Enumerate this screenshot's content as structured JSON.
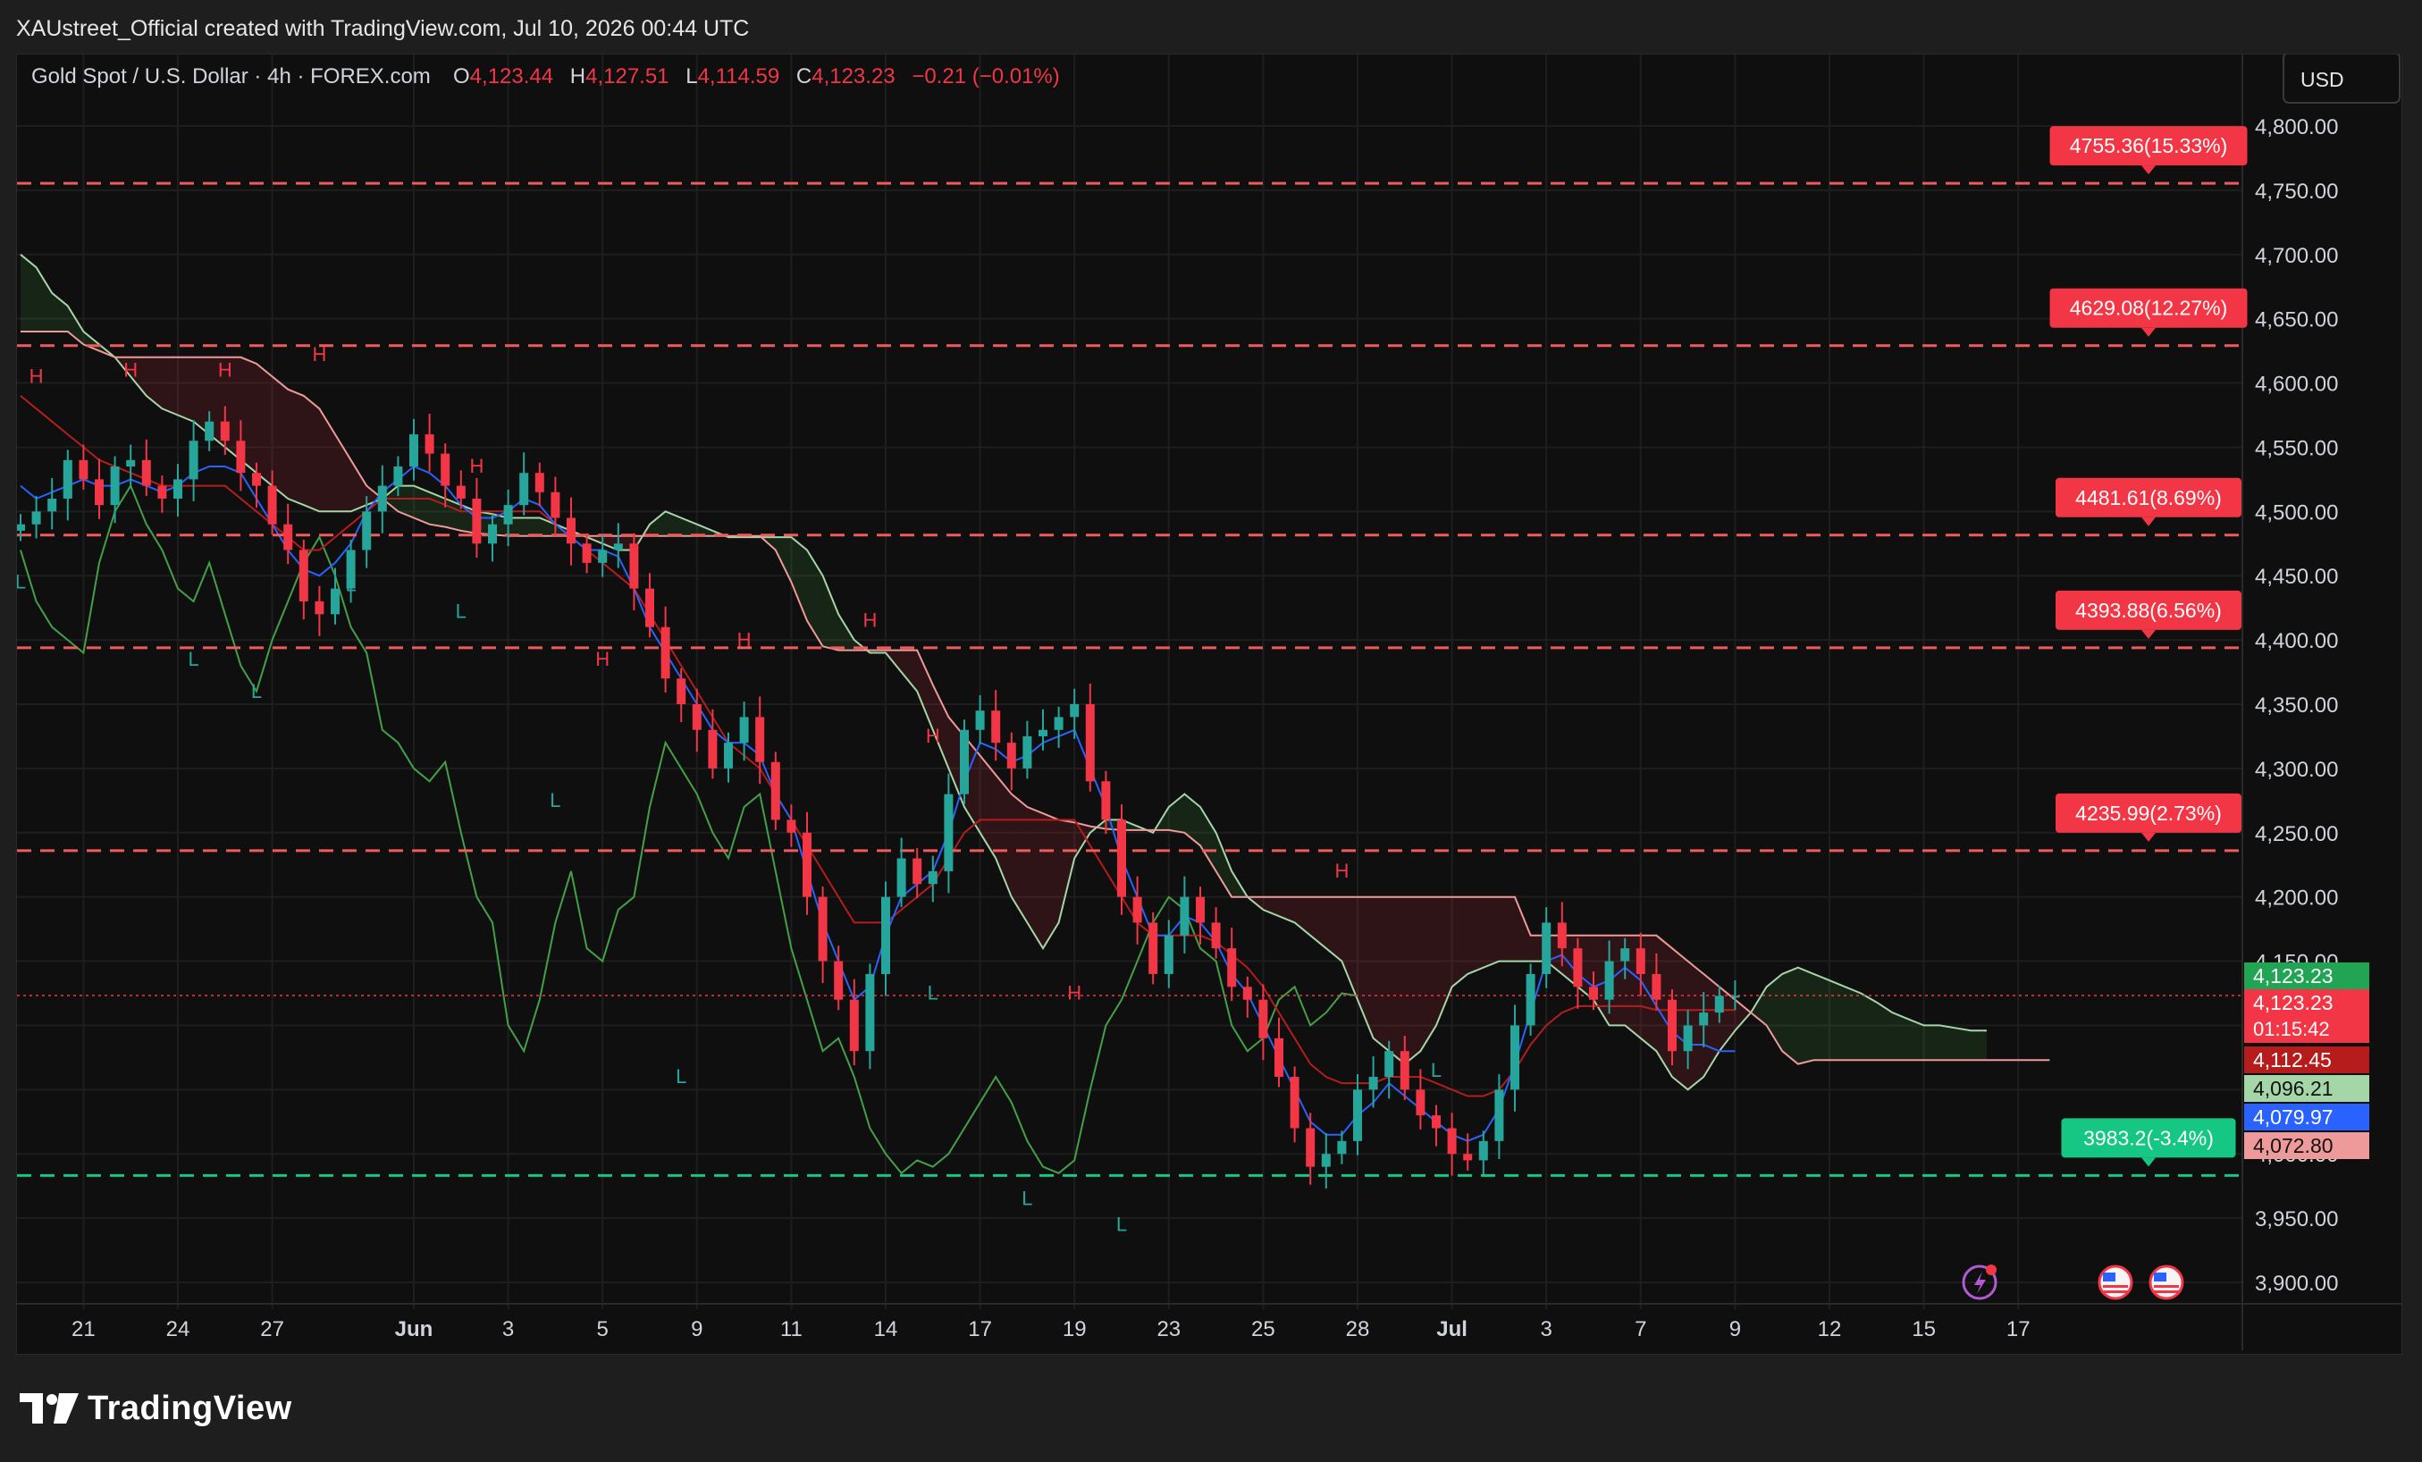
{
  "header": {
    "title": "XAUstreet_Official created with TradingView.com, Jul 10, 2026 00:44 UTC"
  },
  "legend": {
    "symbol": "Gold Spot / U.S. Dollar · 4h · FOREX.com",
    "o_label": "O",
    "o_value": "4,123.44",
    "h_label": "H",
    "h_value": "4,127.51",
    "l_label": "L",
    "l_value": "4,114.59",
    "c_label": "C",
    "c_value": "4,123.23",
    "change": "−0.21 (−0.01%)"
  },
  "currency_button": "USD",
  "footer": {
    "brand": "TradingView"
  },
  "colors": {
    "up": "#26a69a",
    "down": "#f23645",
    "resistance": "#f05a5a",
    "support": "#22c55e",
    "conversion": "#2962ff",
    "base": "#b71c1c",
    "lagging": "#43a047",
    "span_a": "#a5d6a7",
    "span_b": "#ef9a9a"
  },
  "chart_data": {
    "type": "candlestick",
    "y_axis": {
      "min": 3900,
      "max": 4800,
      "ticks": [
        "4,800.00",
        "4,750.00",
        "4,700.00",
        "4,650.00",
        "4,600.00",
        "4,550.00",
        "4,500.00",
        "4,450.00",
        "4,400.00",
        "4,350.00",
        "4,300.00",
        "4,250.00",
        "4,200.00",
        "4,150.00",
        "4,100.00",
        "4,050.00",
        "4,000.00",
        "3,950.00",
        "3,900.00"
      ],
      "tick_values": [
        4800,
        4750,
        4700,
        4650,
        4600,
        4550,
        4500,
        4450,
        4400,
        4350,
        4300,
        4250,
        4200,
        4150,
        4100,
        4050,
        4000,
        3950,
        3900
      ]
    },
    "x_axis": {
      "labels": [
        {
          "text": "21",
          "i": 4,
          "bold": false
        },
        {
          "text": "24",
          "i": 10,
          "bold": false
        },
        {
          "text": "27",
          "i": 16,
          "bold": false
        },
        {
          "text": "Jun",
          "i": 25,
          "bold": true
        },
        {
          "text": "3",
          "i": 31,
          "bold": false
        },
        {
          "text": "5",
          "i": 37,
          "bold": false
        },
        {
          "text": "9",
          "i": 43,
          "bold": false
        },
        {
          "text": "11",
          "i": 49,
          "bold": false
        },
        {
          "text": "14",
          "i": 55,
          "bold": false
        },
        {
          "text": "17",
          "i": 61,
          "bold": false
        },
        {
          "text": "19",
          "i": 67,
          "bold": false
        },
        {
          "text": "23",
          "i": 73,
          "bold": false
        },
        {
          "text": "25",
          "i": 79,
          "bold": false
        },
        {
          "text": "28",
          "i": 85,
          "bold": false
        },
        {
          "text": "Jul",
          "i": 91,
          "bold": true
        },
        {
          "text": "3",
          "i": 97,
          "bold": false
        },
        {
          "text": "7",
          "i": 103,
          "bold": false
        },
        {
          "text": "9",
          "i": 109,
          "bold": false
        },
        {
          "text": "12",
          "i": 115,
          "bold": false
        },
        {
          "text": "15",
          "i": 121,
          "bold": false
        },
        {
          "text": "17",
          "i": 127,
          "bold": false
        }
      ]
    },
    "levels": [
      {
        "value": 4755.36,
        "label": "4755.36(15.33%)",
        "kind": "resistance"
      },
      {
        "value": 4629.08,
        "label": "4629.08(12.27%)",
        "kind": "resistance"
      },
      {
        "value": 4481.61,
        "label": "4481.61(8.69%)",
        "kind": "resistance"
      },
      {
        "value": 4393.88,
        "label": "4393.88(6.56%)",
        "kind": "resistance"
      },
      {
        "value": 4235.99,
        "label": "4235.99(2.73%)",
        "kind": "resistance"
      },
      {
        "value": 3983.2,
        "label": "3983.2(-3.4%)",
        "kind": "support"
      }
    ],
    "last_price": 4123.23,
    "price_tags": [
      {
        "text": "4,123.23",
        "value": 4123.23,
        "color": "#22a455"
      },
      {
        "text": "4,123.23",
        "sub": "01:15:42",
        "value": 4123.23,
        "color": "#f23645"
      },
      {
        "text": "4,112.45",
        "value": 4112.45,
        "color": "#b71c1c"
      },
      {
        "text": "4,096.21",
        "value": 4096.21,
        "color": "#a5d6a7"
      },
      {
        "text": "4,079.97",
        "value": 4079.97,
        "color": "#2962ff"
      },
      {
        "text": "4,072.80",
        "value": 4072.8,
        "color": "#ef9a9a"
      }
    ],
    "close": [
      4490,
      4500,
      4510,
      4540,
      4525,
      4505,
      4535,
      4540,
      4520,
      4510,
      4525,
      4555,
      4570,
      4555,
      4530,
      4520,
      4490,
      4470,
      4430,
      4420,
      4440,
      4470,
      4500,
      4520,
      4535,
      4560,
      4545,
      4520,
      4510,
      4475,
      4490,
      4505,
      4530,
      4515,
      4495,
      4475,
      4460,
      4470,
      4475,
      4440,
      4410,
      4370,
      4350,
      4330,
      4300,
      4320,
      4340,
      4305,
      4260,
      4250,
      4200,
      4150,
      4120,
      4080,
      4140,
      4200,
      4230,
      4210,
      4220,
      4280,
      4330,
      4345,
      4320,
      4300,
      4325,
      4330,
      4340,
      4350,
      4290,
      4260,
      4200,
      4180,
      4140,
      4170,
      4200,
      4180,
      4160,
      4130,
      4120,
      4090,
      4060,
      4020,
      3990,
      4000,
      4010,
      4050,
      4060,
      4080,
      4050,
      4030,
      4020,
      4000,
      3995,
      4010,
      4050,
      4100,
      4140,
      4180,
      4160,
      4130,
      4120,
      4150,
      4160,
      4140,
      4120,
      4080,
      4100,
      4110,
      4123,
      4123
    ],
    "tenkan": [
      4520,
      4510,
      4515,
      4520,
      4525,
      4520,
      4520,
      4525,
      4520,
      4515,
      4520,
      4530,
      4535,
      4535,
      4530,
      4510,
      4490,
      4470,
      4455,
      4450,
      4460,
      4475,
      4500,
      4515,
      4525,
      4535,
      4530,
      4520,
      4505,
      4495,
      4495,
      4500,
      4510,
      4505,
      4490,
      4480,
      4470,
      4470,
      4465,
      4440,
      4410,
      4390,
      4370,
      4350,
      4330,
      4320,
      4320,
      4310,
      4280,
      4260,
      4220,
      4180,
      4150,
      4120,
      4130,
      4170,
      4200,
      4210,
      4220,
      4250,
      4290,
      4320,
      4315,
      4305,
      4310,
      4320,
      4325,
      4330,
      4300,
      4270,
      4230,
      4200,
      4170,
      4170,
      4185,
      4180,
      4165,
      4140,
      4125,
      4100,
      4075,
      4050,
      4025,
      4015,
      4015,
      4030,
      4040,
      4055,
      4045,
      4035,
      4025,
      4015,
      4010,
      4015,
      4035,
      4070,
      4110,
      4150,
      4155,
      4140,
      4130,
      4135,
      4145,
      4135,
      4115,
      4095,
      4085,
      4085,
      4080,
      4080
    ],
    "kijun": [
      4590,
      4580,
      4570,
      4560,
      4550,
      4540,
      4535,
      4530,
      4525,
      4520,
      4520,
      4520,
      4520,
      4520,
      4510,
      4500,
      4490,
      4480,
      4470,
      4470,
      4480,
      4490,
      4500,
      4510,
      4510,
      4510,
      4510,
      4505,
      4500,
      4500,
      4500,
      4500,
      4500,
      4500,
      4490,
      4480,
      4470,
      4460,
      4450,
      4440,
      4420,
      4400,
      4380,
      4360,
      4340,
      4320,
      4310,
      4300,
      4280,
      4260,
      4240,
      4220,
      4200,
      4180,
      4180,
      4180,
      4190,
      4200,
      4210,
      4230,
      4250,
      4260,
      4260,
      4260,
      4260,
      4260,
      4260,
      4260,
      4240,
      4220,
      4200,
      4180,
      4170,
      4170,
      4170,
      4170,
      4165,
      4155,
      4145,
      4130,
      4110,
      4090,
      4070,
      4060,
      4055,
      4055,
      4055,
      4060,
      4060,
      4060,
      4055,
      4050,
      4045,
      4045,
      4050,
      4065,
      4085,
      4100,
      4110,
      4115,
      4115,
      4115,
      4115,
      4115,
      4112,
      4112,
      4112,
      4112,
      4112,
      4112
    ],
    "chikou": [
      4470,
      4430,
      4410,
      4400,
      4390,
      4460,
      4500,
      4520,
      4490,
      4470,
      4440,
      4430,
      4460,
      4420,
      4380,
      4360,
      4400,
      4430,
      4460,
      4480,
      4450,
      4410,
      4390,
      4330,
      4320,
      4300,
      4290,
      4305,
      4250,
      4200,
      4180,
      4100,
      4080,
      4120,
      4180,
      4220,
      4160,
      4150,
      4190,
      4200,
      4270,
      4320,
      4300,
      4280,
      4250,
      4230,
      4270,
      4280,
      4220,
      4160,
      4120,
      4080,
      4090,
      4060,
      4020,
      4000,
      3985,
      3995,
      3990,
      4000,
      4020,
      4040,
      4060,
      4040,
      4010,
      3990,
      3985,
      3995,
      4050,
      4100,
      4120,
      4150,
      4180,
      4200,
      4190,
      4160,
      4150,
      4100,
      4080,
      4090,
      4120,
      4130,
      4100,
      4110,
      4125,
      4123
    ],
    "span_a": [
      4700,
      4690,
      4670,
      4660,
      4640,
      4630,
      4620,
      4605,
      4590,
      4580,
      4575,
      4570,
      4560,
      4550,
      4540,
      4530,
      4520,
      4510,
      4505,
      4500,
      4500,
      4500,
      4505,
      4510,
      4520,
      4520,
      4515,
      4510,
      4505,
      4500,
      4498,
      4495,
      4495,
      4495,
      4490,
      4485,
      4480,
      4475,
      4470,
      4470,
      4490,
      4500,
      4495,
      4490,
      4485,
      4480,
      4480,
      4480,
      4480,
      4480,
      4470,
      4450,
      4420,
      4400,
      4390,
      4390,
      4375,
      4360,
      4330,
      4300,
      4270,
      4250,
      4230,
      4200,
      4180,
      4160,
      4180,
      4230,
      4250,
      4260,
      4260,
      4255,
      4250,
      4270,
      4280,
      4270,
      4250,
      4220,
      4200,
      4190,
      4185,
      4180,
      4170,
      4160,
      4150,
      4120,
      4090,
      4080,
      4070,
      4080,
      4100,
      4130,
      4140,
      4145,
      4150,
      4150,
      4150,
      4150,
      4140,
      4130,
      4120,
      4100,
      4100,
      4090,
      4080,
      4060,
      4050,
      4060,
      4080,
      4096,
      4110,
      4130,
      4140,
      4145,
      4140,
      4135,
      4130,
      4125,
      4118,
      4110,
      4105,
      4100,
      4100,
      4098,
      4096,
      4096
    ],
    "span_b": [
      4640,
      4640,
      4640,
      4640,
      4630,
      4625,
      4620,
      4620,
      4620,
      4620,
      4620,
      4620,
      4620,
      4620,
      4620,
      4615,
      4605,
      4595,
      4590,
      4580,
      4560,
      4540,
      4520,
      4510,
      4500,
      4495,
      4490,
      4488,
      4485,
      4483,
      4482,
      4481,
      4481,
      4481,
      4481,
      4481,
      4481,
      4481,
      4481,
      4481,
      4481,
      4481,
      4481,
      4481,
      4481,
      4481,
      4481,
      4481,
      4470,
      4445,
      4415,
      4395,
      4392,
      4392,
      4392,
      4392,
      4392,
      4392,
      4365,
      4340,
      4325,
      4310,
      4295,
      4280,
      4270,
      4265,
      4260,
      4258,
      4255,
      4253,
      4252,
      4252,
      4252,
      4252,
      4250,
      4240,
      4220,
      4200,
      4200,
      4200,
      4200,
      4200,
      4200,
      4200,
      4200,
      4200,
      4200,
      4200,
      4200,
      4200,
      4200,
      4200,
      4200,
      4200,
      4200,
      4200,
      4170,
      4170,
      4170,
      4170,
      4170,
      4170,
      4170,
      4170,
      4170,
      4160,
      4150,
      4140,
      4130,
      4120,
      4110,
      4100,
      4080,
      4070,
      4073,
      4073,
      4073,
      4073,
      4073,
      4073,
      4073,
      4073,
      4073,
      4073,
      4073,
      4073,
      4073,
      4073,
      4073,
      4073
    ],
    "hl_labels": [
      {
        "t": "H",
        "i": 1,
        "v": 4600
      },
      {
        "t": "L",
        "i": 0,
        "v": 4440
      },
      {
        "t": "H",
        "i": 7,
        "v": 4605
      },
      {
        "t": "H",
        "i": 13,
        "v": 4605
      },
      {
        "t": "L",
        "i": 11,
        "v": 4380
      },
      {
        "t": "L",
        "i": 15,
        "v": 4355
      },
      {
        "t": "H",
        "i": 19,
        "v": 4617
      },
      {
        "t": "L",
        "i": 21,
        "v": 4438
      },
      {
        "t": "H",
        "i": 29,
        "v": 4530
      },
      {
        "t": "L",
        "i": 28,
        "v": 4417
      },
      {
        "t": "L",
        "i": 34,
        "v": 4270
      },
      {
        "t": "H",
        "i": 37,
        "v": 4380
      },
      {
        "t": "H",
        "i": 46,
        "v": 4395
      },
      {
        "t": "L",
        "i": 42,
        "v": 4055
      },
      {
        "t": "H",
        "i": 54,
        "v": 4410
      },
      {
        "t": "H",
        "i": 58,
        "v": 4320
      },
      {
        "t": "L",
        "i": 58,
        "v": 4120
      },
      {
        "t": "H",
        "i": 67,
        "v": 4120
      },
      {
        "t": "L",
        "i": 64,
        "v": 3960
      },
      {
        "t": "L",
        "i": 70,
        "v": 3940
      },
      {
        "t": "H",
        "i": 84,
        "v": 4215
      },
      {
        "t": "L",
        "i": 90,
        "v": 4060
      }
    ]
  }
}
